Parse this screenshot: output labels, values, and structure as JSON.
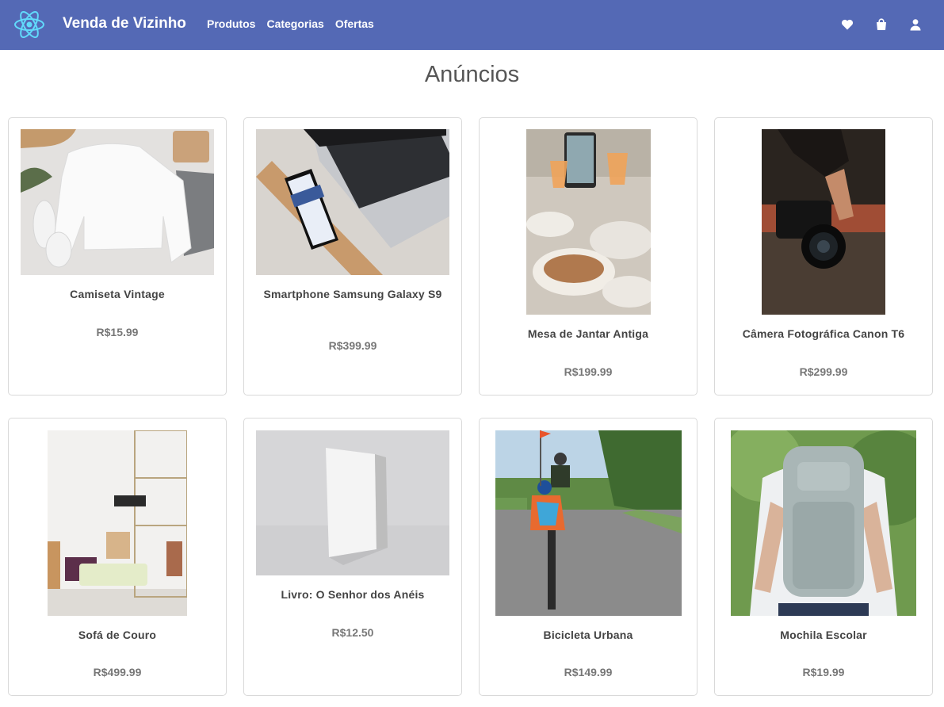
{
  "header": {
    "brand": "Venda de Vizinho",
    "nav": [
      "Produtos",
      "Categorias",
      "Ofertas"
    ],
    "bg_color": "#5469b5",
    "icons": [
      "react-logo-icon",
      "heart-icon",
      "shopping-bag-icon",
      "user-icon"
    ]
  },
  "page": {
    "title": "Anúncios"
  },
  "listings": [
    {
      "title": "Camiseta Vintage",
      "price": "R$15.99",
      "image": "white-sweatshirt-flatlay"
    },
    {
      "title": "Smartphone Samsung Galaxy S9",
      "price": "R$399.99",
      "image": "smartphone-and-laptop"
    },
    {
      "title": "Mesa de Jantar Antiga",
      "price": "R$199.99",
      "image": "dining-table-with-food"
    },
    {
      "title": "Câmera Fotográfica Canon T6",
      "price": "R$299.99",
      "image": "hand-holding-camera"
    },
    {
      "title": "Sofá de Couro",
      "price": "R$499.99",
      "image": "living-room-with-sofa"
    },
    {
      "title": "Livro: O Senhor dos Anéis",
      "price": "R$12.50",
      "image": "white-book"
    },
    {
      "title": "Bicicleta Urbana",
      "price": "R$149.99",
      "image": "kids-cycling-on-road"
    },
    {
      "title": "Mochila Escolar",
      "price": "R$19.99",
      "image": "person-with-grey-backpack"
    }
  ]
}
